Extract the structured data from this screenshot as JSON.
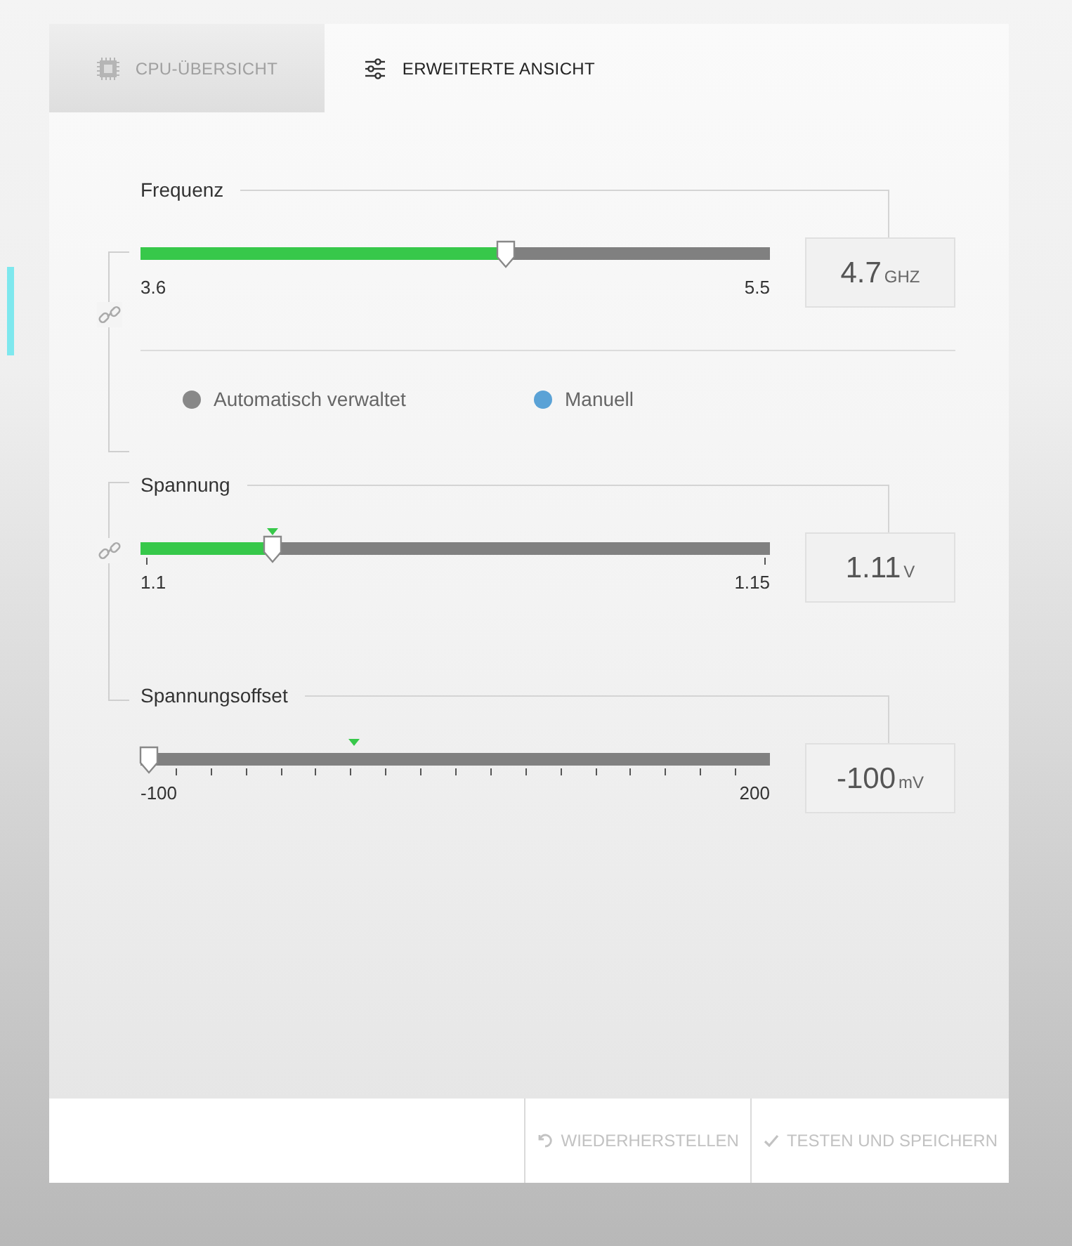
{
  "tabs": [
    {
      "label": "CPU-ÜBERSICHT",
      "kind": "chip",
      "selected": false
    },
    {
      "label": "ERWEITERTE ANSICHT",
      "kind": "sliders",
      "selected": true
    }
  ],
  "groups": [
    {
      "linked": true,
      "sliders": [
        {
          "label": "Frequenz",
          "min": "3.6",
          "max": "5.5",
          "level": 0.58,
          "kind": "plain",
          "value": "4.7",
          "unit": "GHZ"
        }
      ],
      "mode": [
        {
          "label": "Automatisch verwaltet",
          "selected": false
        },
        {
          "label": "Manuell",
          "selected": true
        }
      ]
    },
    {
      "linked": true,
      "sliders": [
        {
          "label": "Spannung",
          "min": "1.1",
          "max": "1.15",
          "level": 0.21,
          "kind": "end_ticks",
          "default_marker": {
            "level": 0.21
          },
          "value": "1.11",
          "unit": "V"
        }
      ]
    },
    {
      "linked": false,
      "sliders": [
        {
          "label": "Spannungsoffset",
          "min": "-100",
          "max": "200",
          "level": 0,
          "kind": "scale",
          "default_marker": {
            "level": 0.34
          },
          "value": "-100",
          "unit": "mV"
        }
      ]
    }
  ],
  "footer": {
    "buttons": [
      {
        "label": "WIEDERHERSTELLEN",
        "kind": "reset",
        "disabled": true
      },
      {
        "label": "TESTEN UND SPEICHERN",
        "kind": "save",
        "disabled": true
      }
    ]
  }
}
